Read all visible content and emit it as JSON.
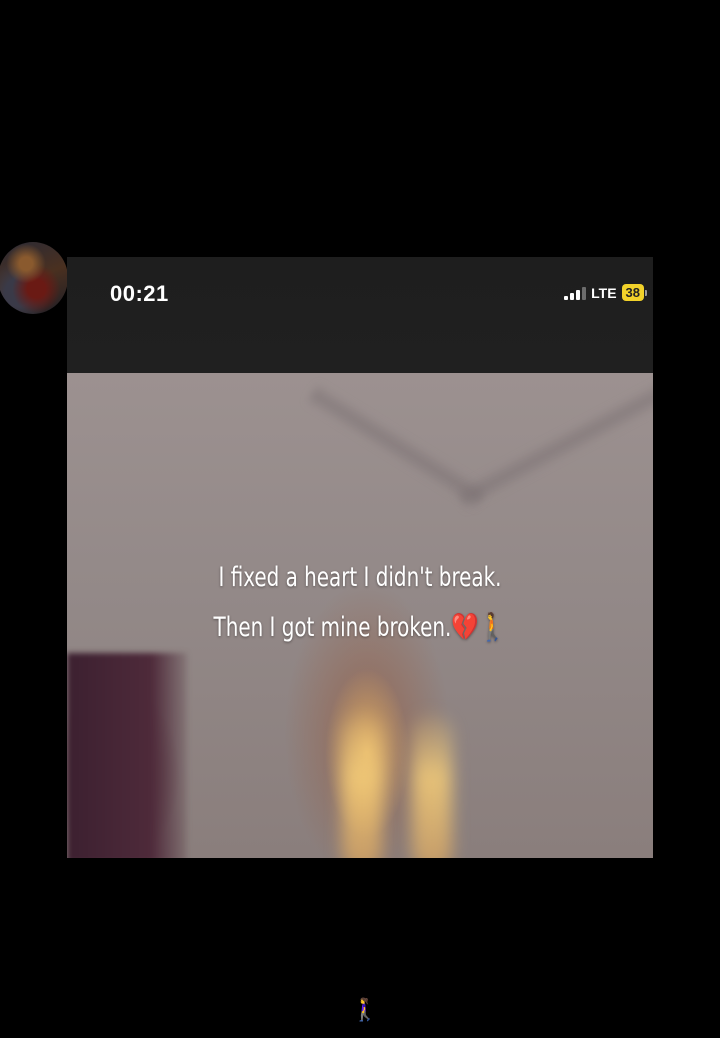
{
  "status_bar": {
    "time": "00:21",
    "network": "LTE",
    "battery": "38"
  },
  "post": {
    "line1": "I fixed a heart I didn't break.",
    "line2": "Then I got mine broken.💔🚶"
  },
  "footer": {
    "emoji": "🚶‍♀️"
  },
  "colors": {
    "background": "#000000",
    "battery": "#f2d22a"
  }
}
